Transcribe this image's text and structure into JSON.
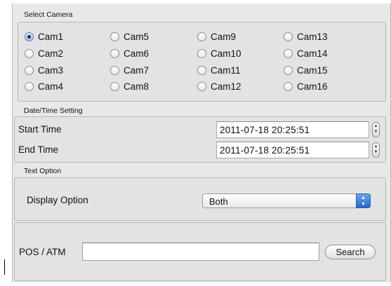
{
  "select_camera": {
    "title": "Select Camera",
    "cameras": [
      "Cam1",
      "Cam2",
      "Cam3",
      "Cam4",
      "Cam5",
      "Cam6",
      "Cam7",
      "Cam8",
      "Cam9",
      "Cam10",
      "Cam11",
      "Cam12",
      "Cam13",
      "Cam14",
      "Cam15",
      "Cam16"
    ],
    "selected": "Cam1"
  },
  "datetime": {
    "title": "Date/Time Setting",
    "start_label": "Start Time",
    "start_value": "2011-07-18 20:25:51",
    "end_label": "End Time",
    "end_value": "2011-07-18 20:25:51"
  },
  "text_option": {
    "title": "Text Option",
    "display_label": "Display Option",
    "display_value": "Both"
  },
  "pos_atm": {
    "label": "POS / ATM",
    "input_value": "",
    "search_label": "Search"
  },
  "colors": {
    "accent": "#2766c8",
    "panel": "#e3e3e3"
  }
}
